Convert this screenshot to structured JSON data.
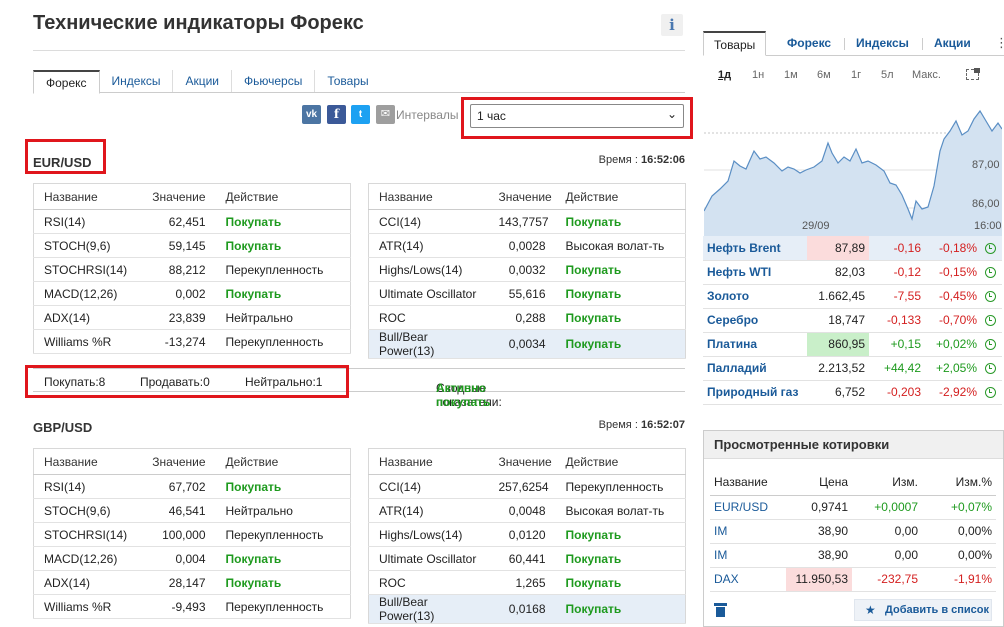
{
  "page": {
    "title": "Технические индикаторы Форекс",
    "info_icon": "i"
  },
  "tabs": [
    "Форекс",
    "Индексы",
    "Акции",
    "Фьючерсы",
    "Товары"
  ],
  "share": {
    "vk": "vk",
    "fb": "f",
    "tw": "t",
    "mail": "✉"
  },
  "interval": {
    "label": "Интервалы",
    "selected": "1 час"
  },
  "headers": {
    "name": "Название",
    "value": "Значение",
    "action": "Действие"
  },
  "sections": [
    {
      "pair": "EUR/USD",
      "time_label": "Время :",
      "time": "16:52:06",
      "left": [
        {
          "name": "RSI(14)",
          "value": "62,451",
          "action": "Покупать",
          "buy": true
        },
        {
          "name": "STOCH(9,6)",
          "value": "59,145",
          "action": "Покупать",
          "buy": true
        },
        {
          "name": "STOCHRSI(14)",
          "value": "88,212",
          "action": "Перекупленность",
          "buy": false
        },
        {
          "name": "MACD(12,26)",
          "value": "0,002",
          "action": "Покупать",
          "buy": true
        },
        {
          "name": "ADX(14)",
          "value": "23,839",
          "action": "Нейтрально",
          "buy": false
        },
        {
          "name": "Williams %R",
          "value": "-13,274",
          "action": "Перекупленность",
          "buy": false
        }
      ],
      "right": [
        {
          "name": "CCI(14)",
          "value": "143,7757",
          "action": "Покупать",
          "buy": true
        },
        {
          "name": "ATR(14)",
          "value": "0,0028",
          "action": "Высокая волат-ть",
          "buy": false
        },
        {
          "name": "Highs/Lows(14)",
          "value": "0,0032",
          "action": "Покупать",
          "buy": true
        },
        {
          "name": "Ultimate Oscillator",
          "value": "55,616",
          "action": "Покупать",
          "buy": true
        },
        {
          "name": "ROC",
          "value": "0,288",
          "action": "Покупать",
          "buy": true
        },
        {
          "name": "Bull/Bear Power(13)",
          "value": "0,0034",
          "action": "Покупать",
          "buy": true
        }
      ],
      "summary": {
        "buy": "Покупать:8",
        "sell": "Продавать:0",
        "neutral": "Нейтрально:1",
        "label": "Сводные показатели:",
        "verdict": "Активно покупать"
      }
    },
    {
      "pair": "GBP/USD",
      "time_label": "Время :",
      "time": "16:52:07",
      "left": [
        {
          "name": "RSI(14)",
          "value": "67,702",
          "action": "Покупать",
          "buy": true
        },
        {
          "name": "STOCH(9,6)",
          "value": "46,541",
          "action": "Нейтрально",
          "buy": false
        },
        {
          "name": "STOCHRSI(14)",
          "value": "100,000",
          "action": "Перекупленность",
          "buy": false
        },
        {
          "name": "MACD(12,26)",
          "value": "0,004",
          "action": "Покупать",
          "buy": true
        },
        {
          "name": "ADX(14)",
          "value": "28,147",
          "action": "Покупать",
          "buy": true
        },
        {
          "name": "Williams %R",
          "value": "-9,493",
          "action": "Перекупленность",
          "buy": false
        }
      ],
      "right": [
        {
          "name": "CCI(14)",
          "value": "257,6254",
          "action": "Перекупленность",
          "buy": false
        },
        {
          "name": "ATR(14)",
          "value": "0,0048",
          "action": "Высокая волат-ть",
          "buy": false
        },
        {
          "name": "Highs/Lows(14)",
          "value": "0,0120",
          "action": "Покупать",
          "buy": true
        },
        {
          "name": "Ultimate Oscillator",
          "value": "60,441",
          "action": "Покупать",
          "buy": true
        },
        {
          "name": "ROC",
          "value": "1,265",
          "action": "Покупать",
          "buy": true
        },
        {
          "name": "Bull/Bear Power(13)",
          "value": "0,0168",
          "action": "Покупать",
          "buy": true
        }
      ]
    }
  ],
  "right_panel": {
    "tabs": [
      "Товары",
      "Форекс",
      "Индексы",
      "Акции"
    ],
    "more": "⋮",
    "ranges": [
      "1д",
      "1н",
      "1м",
      "6м",
      "1г",
      "5л",
      "Макс."
    ],
    "chart": {
      "y_labels": [
        "87,00",
        "86,00"
      ],
      "x_labels": [
        "29/09",
        "16:00"
      ],
      "color_line": "#5a8ec4",
      "color_fill": "#d3e2f1"
    },
    "quotes": [
      {
        "name": "Нефть Brent",
        "price": "87,89",
        "change": "-0,16",
        "pct": "-0,18%",
        "dir": "neg",
        "hl": "red",
        "rowhl": true
      },
      {
        "name": "Нефть WTI",
        "price": "82,03",
        "change": "-0,12",
        "pct": "-0,15%",
        "dir": "neg",
        "hl": "",
        "rowhl": false
      },
      {
        "name": "Золото",
        "price": "1.662,45",
        "change": "-7,55",
        "pct": "-0,45%",
        "dir": "neg",
        "hl": "",
        "rowhl": false
      },
      {
        "name": "Серебро",
        "price": "18,747",
        "change": "-0,133",
        "pct": "-0,70%",
        "dir": "neg",
        "hl": "",
        "rowhl": false
      },
      {
        "name": "Платина",
        "price": "860,95",
        "change": "+0,15",
        "pct": "+0,02%",
        "dir": "pos",
        "hl": "green",
        "rowhl": false
      },
      {
        "name": "Палладий",
        "price": "2.213,52",
        "change": "+44,42",
        "pct": "+2,05%",
        "dir": "pos",
        "hl": "",
        "rowhl": false
      },
      {
        "name": "Природный газ",
        "price": "6,752",
        "change": "-0,203",
        "pct": "-2,92%",
        "dir": "neg",
        "hl": "",
        "rowhl": false
      }
    ]
  },
  "viewed": {
    "title": "Просмотренные котировки",
    "headers": {
      "name": "Название",
      "price": "Цена",
      "change": "Изм.",
      "pct": "Изм.%"
    },
    "rows": [
      {
        "name": "EUR/USD",
        "price": "0,9741",
        "change": "+0,0007",
        "pct": "+0,07%",
        "dir": "pos",
        "hl": ""
      },
      {
        "name": "IM",
        "price": "38,90",
        "change": "0,00",
        "pct": "0,00%",
        "dir": "zero",
        "hl": ""
      },
      {
        "name": "IM",
        "price": "38,90",
        "change": "0,00",
        "pct": "0,00%",
        "dir": "zero",
        "hl": ""
      },
      {
        "name": "DAX",
        "price": "11.950,53",
        "change": "-232,75",
        "pct": "-1,91%",
        "dir": "neg",
        "hl": "red"
      }
    ],
    "add_label": "Добавить в список"
  }
}
